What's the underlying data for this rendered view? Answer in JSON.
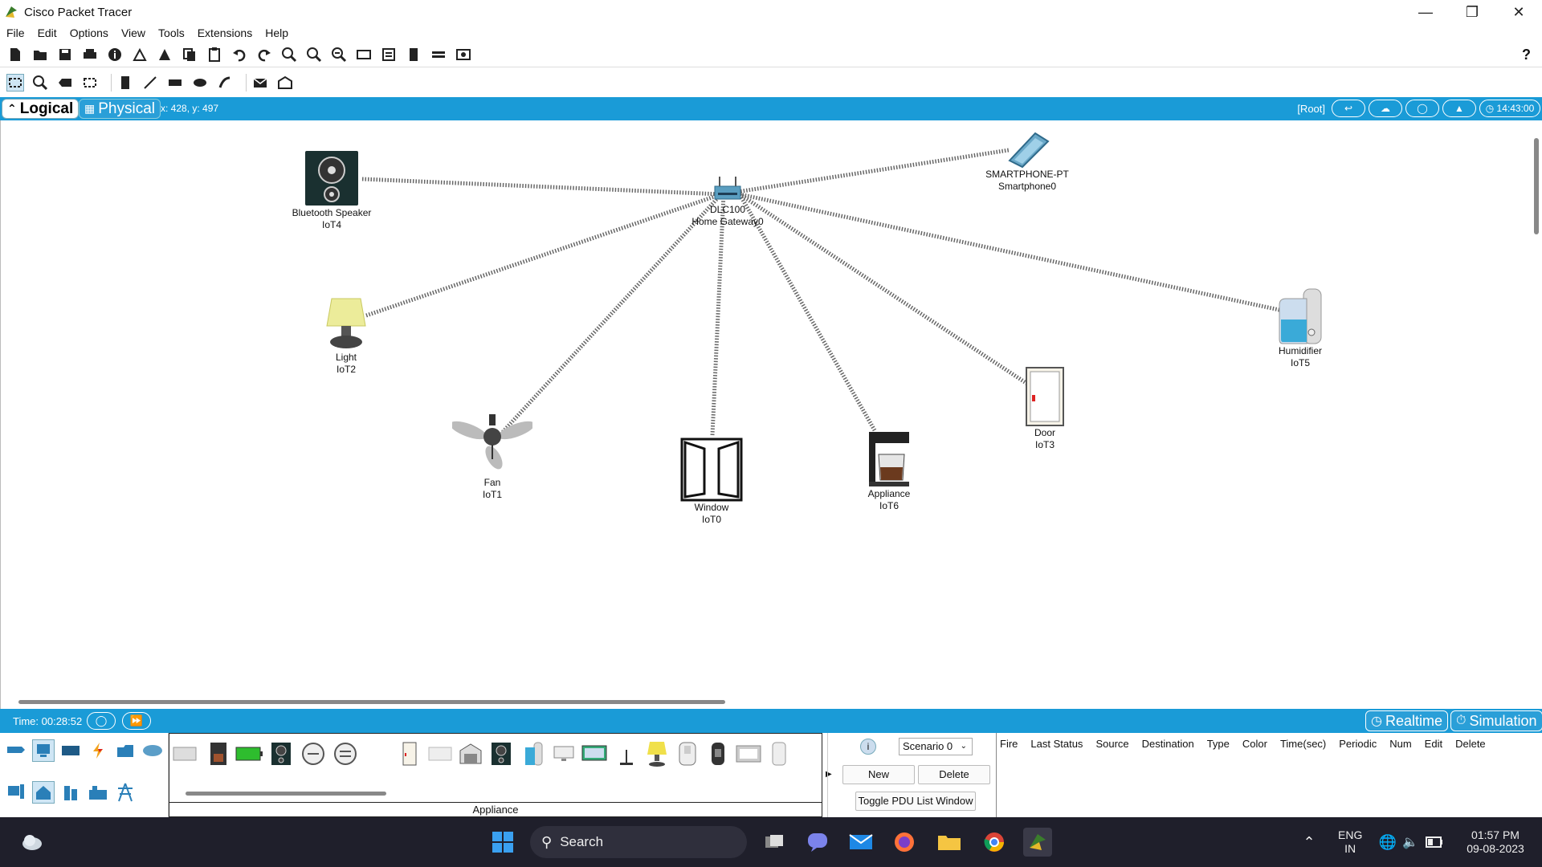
{
  "window": {
    "title": "Cisco Packet Tracer"
  },
  "menu": [
    "File",
    "Edit",
    "Options",
    "View",
    "Tools",
    "Extensions",
    "Help"
  ],
  "help_label": "?",
  "modebar": {
    "logical": "Logical",
    "physical": "Physical",
    "coordinates": "x: 428, y: 497",
    "root": "[Root]",
    "clock": "14:43:00"
  },
  "devices": [
    {
      "name": "Bluetooth Speaker",
      "id": "IoT4"
    },
    {
      "name": "DLC100\nHome Gateway0",
      "id": ""
    },
    {
      "name": "SMARTPHONE-PT",
      "id": "Smartphone0"
    },
    {
      "name": "Light",
      "id": "IoT2"
    },
    {
      "name": "Fan",
      "id": "IoT1"
    },
    {
      "name": "Window",
      "id": "IoT0"
    },
    {
      "name": "Appliance",
      "id": "IoT6"
    },
    {
      "name": "Door",
      "id": "IoT3"
    },
    {
      "name": "Humidifier",
      "id": "IoT5"
    }
  ],
  "gateway": {
    "line1": "DLC100",
    "line2": "Home Gateway0"
  },
  "timebar": {
    "time": "Time: 00:28:52",
    "realtime": "Realtime",
    "simulation": "Simulation"
  },
  "device_panel": {
    "caption": "Appliance"
  },
  "scenario": {
    "selected": "Scenario 0",
    "new": "New",
    "delete": "Delete",
    "toggle": "Toggle PDU List Window"
  },
  "pdu_columns": [
    "Fire",
    "Last Status",
    "Source",
    "Destination",
    "Type",
    "Color",
    "Time(sec)",
    "Periodic",
    "Num",
    "Edit",
    "Delete"
  ],
  "taskbar": {
    "search": "Search",
    "lang1": "ENG",
    "lang2": "IN",
    "time": "01:57 PM",
    "date": "09-08-2023"
  },
  "colors": {
    "accent": "#1a9bd7",
    "taskbar": "#1f1f2b"
  }
}
